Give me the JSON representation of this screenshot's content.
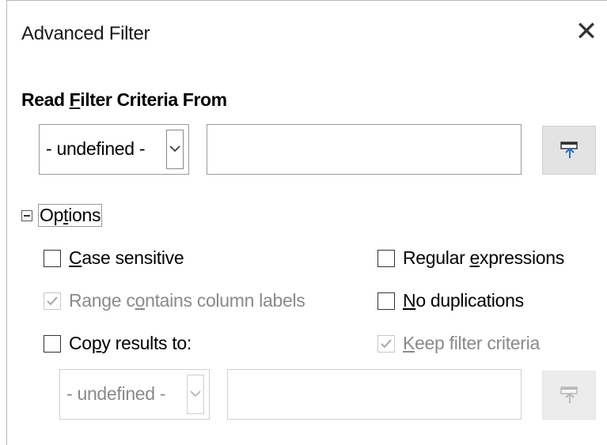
{
  "window": {
    "title": "Advanced Filter",
    "close_glyph": "✕"
  },
  "read_criteria": {
    "label_prefix": "Read ",
    "label_mnemonic": "F",
    "label_suffix": "ilter Criteria From",
    "range_select_value": "- undefined -",
    "range_input_value": ""
  },
  "options": {
    "expander_symbol": "minus",
    "label_prefix": "Op",
    "label_mnemonic": "t",
    "label_suffix": "ions",
    "case_sensitive": {
      "mnemonic": "C",
      "rest": "ase sensitive",
      "checked": false,
      "enabled": true
    },
    "regular_expressions": {
      "prefix": "Regular ",
      "mnemonic": "e",
      "rest": "xpressions",
      "checked": false,
      "enabled": true
    },
    "range_contains_labels": {
      "prefix": "Range c",
      "mnemonic": "o",
      "rest": "ntains column labels",
      "checked": true,
      "enabled": false
    },
    "no_duplications": {
      "mnemonic": "N",
      "rest": "o duplications",
      "checked": false,
      "enabled": true
    },
    "copy_results": {
      "prefix": "Co",
      "mnemonic": "p",
      "rest": "y results to:",
      "checked": false,
      "enabled": true
    },
    "keep_filter_criteria": {
      "mnemonic": "K",
      "rest": "eep filter criteria",
      "checked": true,
      "enabled": false
    },
    "copy_target_select_value": "- undefined -",
    "copy_target_input_value": ""
  },
  "icons": {
    "shrink": "shrink-icon",
    "dropdown": "chevron-down-icon",
    "check": "checkmark-icon",
    "close": "close-icon"
  },
  "colors": {
    "disabled_text": "#8a8a8a",
    "button_bg": "#e3e3e3",
    "shrink_arrow": "#1e6fd0"
  }
}
